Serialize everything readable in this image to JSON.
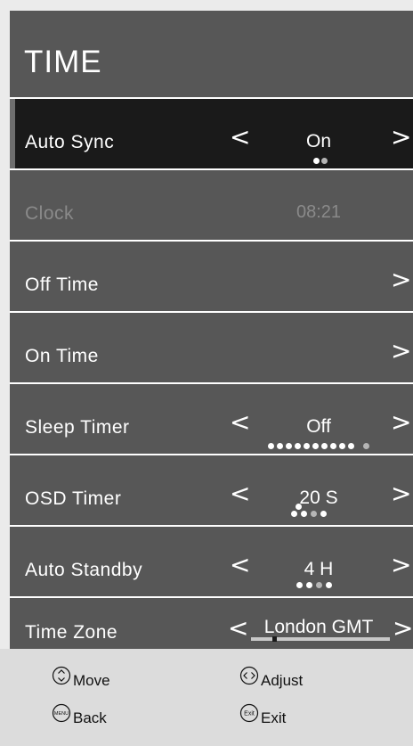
{
  "title": "TIME",
  "rows": {
    "auto_sync": {
      "label": "Auto Sync",
      "value": "On"
    },
    "clock": {
      "label": "Clock",
      "value": "08:21"
    },
    "off_time": {
      "label": "Off Time"
    },
    "on_time": {
      "label": "On Time"
    },
    "sleep_timer": {
      "label": "Sleep Timer",
      "value": "Off"
    },
    "osd_timer": {
      "label": "OSD Timer",
      "value": "20 S"
    },
    "auto_standby": {
      "label": "Auto Standby",
      "value": "4 H"
    },
    "time_zone": {
      "label": "Time Zone",
      "value": "London GMT"
    }
  },
  "arrows": {
    "left": "<",
    "right": ">"
  },
  "footer": {
    "move": "Move",
    "adjust": "Adjust",
    "back": "Back",
    "exit": "Exit",
    "menu_icon_text": "MENU",
    "exit_icon_text": "Exit"
  },
  "colors": {
    "panel": "#575757",
    "selected_row": "#1a1a1a",
    "disabled_text": "#8a8a8a",
    "footer": "#dcdcdc"
  }
}
